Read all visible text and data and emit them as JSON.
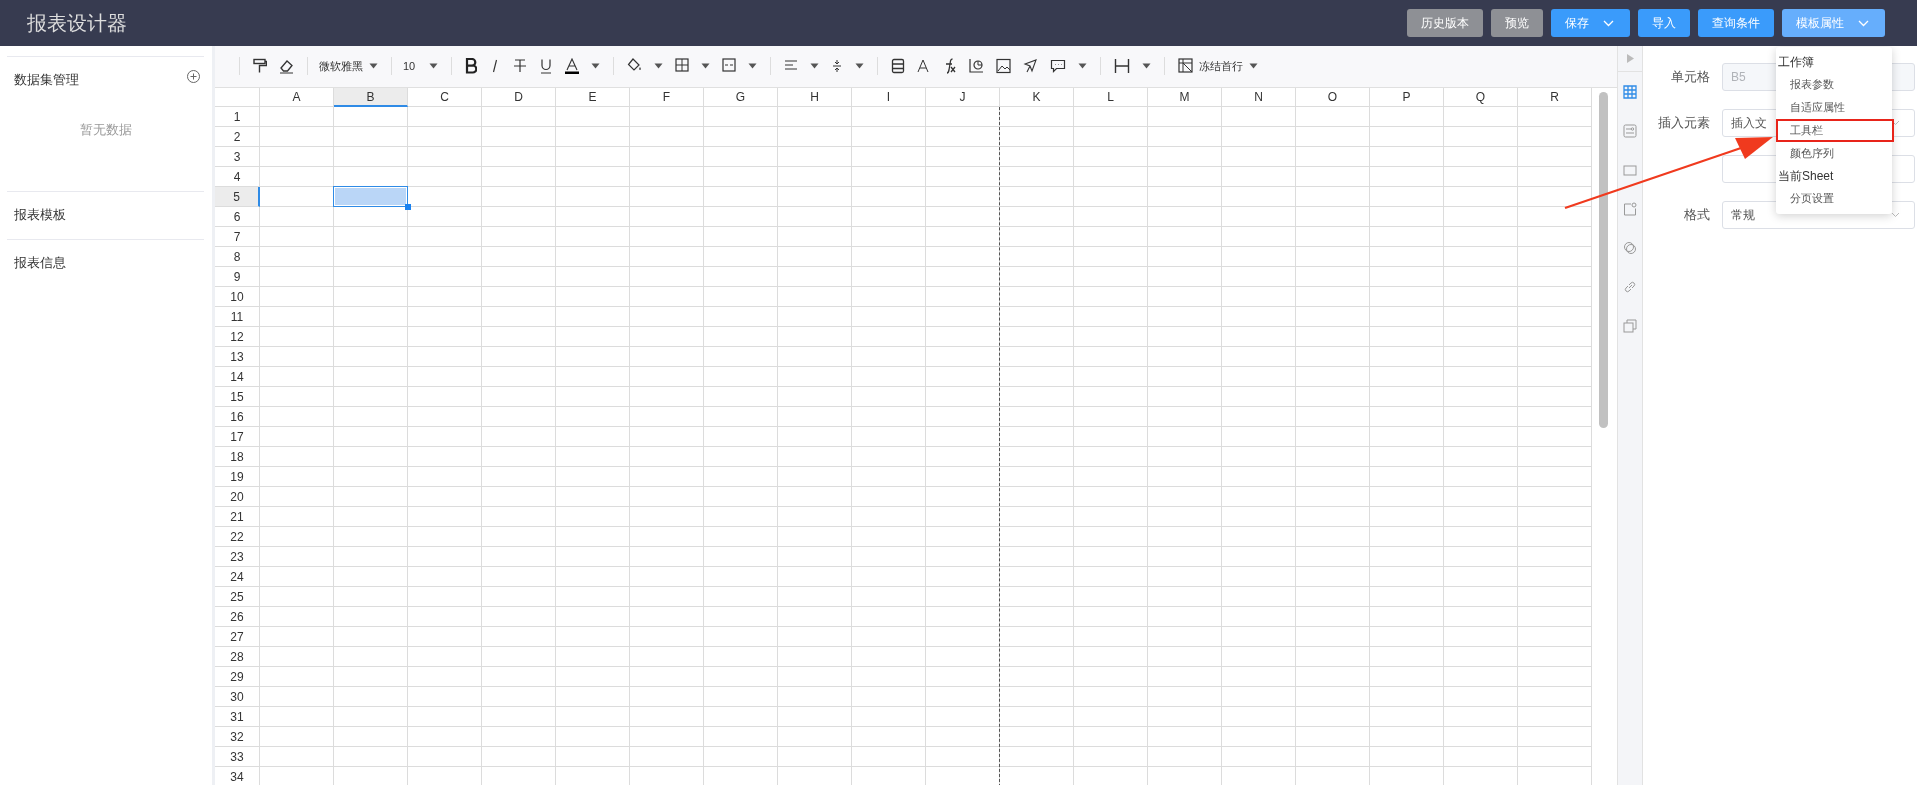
{
  "app": {
    "title": "报表设计器"
  },
  "header_buttons": [
    {
      "label": "历史版本",
      "kind": "secondary",
      "caret": false,
      "expanded": false
    },
    {
      "label": "预览",
      "kind": "secondary",
      "caret": false,
      "expanded": false
    },
    {
      "label": "保存",
      "kind": "primary",
      "caret": true,
      "expanded": false
    },
    {
      "label": "导入",
      "kind": "primary",
      "caret": false,
      "expanded": false
    },
    {
      "label": "查询条件",
      "kind": "primary",
      "caret": false,
      "expanded": false
    },
    {
      "label": "模板属性",
      "kind": "primary",
      "caret": true,
      "expanded": true
    }
  ],
  "sidebar": [
    {
      "title": "数据集管理",
      "add_button": true,
      "empty_text": "暂无数据"
    },
    {
      "title": "报表模板",
      "add_button": false
    },
    {
      "title": "报表信息",
      "add_button": false
    }
  ],
  "toolbar": {
    "font": "微软雅黑",
    "size": "10",
    "freeze": "冻结首行"
  },
  "sheet": {
    "columns": [
      {
        "label": "A",
        "selected": false,
        "page_break": false
      },
      {
        "label": "B",
        "selected": true,
        "page_break": false
      },
      {
        "label": "C",
        "selected": false,
        "page_break": false
      },
      {
        "label": "D",
        "selected": false,
        "page_break": false
      },
      {
        "label": "E",
        "selected": false,
        "page_break": false
      },
      {
        "label": "F",
        "selected": false,
        "page_break": false
      },
      {
        "label": "G",
        "selected": false,
        "page_break": false
      },
      {
        "label": "H",
        "selected": false,
        "page_break": false
      },
      {
        "label": "I",
        "selected": false,
        "page_break": false
      },
      {
        "label": "J",
        "selected": false,
        "page_break": true
      },
      {
        "label": "K",
        "selected": false,
        "page_break": false
      },
      {
        "label": "L",
        "selected": false,
        "page_break": false
      },
      {
        "label": "M",
        "selected": false,
        "page_break": false
      },
      {
        "label": "N",
        "selected": false,
        "page_break": false
      },
      {
        "label": "O",
        "selected": false,
        "page_break": false
      },
      {
        "label": "P",
        "selected": false,
        "page_break": false
      },
      {
        "label": "Q",
        "selected": false,
        "page_break": false
      },
      {
        "label": "R",
        "selected": false,
        "page_break": false
      }
    ],
    "rows": [
      {
        "label": "1",
        "selected": false
      },
      {
        "label": "2",
        "selected": false
      },
      {
        "label": "3",
        "selected": false
      },
      {
        "label": "4",
        "selected": false
      },
      {
        "label": "5",
        "selected": true
      },
      {
        "label": "6",
        "selected": false
      },
      {
        "label": "7",
        "selected": false
      },
      {
        "label": "8",
        "selected": false
      },
      {
        "label": "9",
        "selected": false
      },
      {
        "label": "10",
        "selected": false
      },
      {
        "label": "11",
        "selected": false
      },
      {
        "label": "12",
        "selected": false
      },
      {
        "label": "13",
        "selected": false
      },
      {
        "label": "14",
        "selected": false
      },
      {
        "label": "15",
        "selected": false
      },
      {
        "label": "16",
        "selected": false
      },
      {
        "label": "17",
        "selected": false
      },
      {
        "label": "18",
        "selected": false
      },
      {
        "label": "19",
        "selected": false
      },
      {
        "label": "20",
        "selected": false
      },
      {
        "label": "21",
        "selected": false
      },
      {
        "label": "22",
        "selected": false
      },
      {
        "label": "23",
        "selected": false
      },
      {
        "label": "24",
        "selected": false
      },
      {
        "label": "25",
        "selected": false
      },
      {
        "label": "26",
        "selected": false
      },
      {
        "label": "27",
        "selected": false
      },
      {
        "label": "28",
        "selected": false
      },
      {
        "label": "29",
        "selected": false
      },
      {
        "label": "30",
        "selected": false
      },
      {
        "label": "31",
        "selected": false
      },
      {
        "label": "32",
        "selected": false
      },
      {
        "label": "33",
        "selected": false
      },
      {
        "label": "34",
        "selected": false
      }
    ]
  },
  "side_tabs": [
    {
      "selected": true
    },
    {
      "selected": false
    },
    {
      "selected": false
    },
    {
      "selected": false
    },
    {
      "selected": false
    },
    {
      "selected": false
    },
    {
      "selected": false
    }
  ],
  "properties": [
    {
      "kind": "input",
      "label": "单元格",
      "value": "B5",
      "disabled": true
    },
    {
      "kind": "select",
      "label": "插入元素",
      "value": "插入文",
      "disabled": false
    },
    {
      "kind": "input"
    },
    {
      "kind": "select",
      "label": "格式",
      "value": "常规",
      "disabled": false
    }
  ],
  "menu": {
    "groups": [
      {
        "title": "工作簿",
        "items": [
          {
            "label": "报表参数",
            "highlighted": false
          },
          {
            "label": "自适应属性",
            "highlighted": false
          },
          {
            "label": "工具栏",
            "highlighted": true
          },
          {
            "label": "颜色序列",
            "highlighted": false
          }
        ]
      },
      {
        "title": "当前Sheet",
        "items": [
          {
            "label": "分页设置",
            "highlighted": false
          }
        ]
      }
    ]
  }
}
